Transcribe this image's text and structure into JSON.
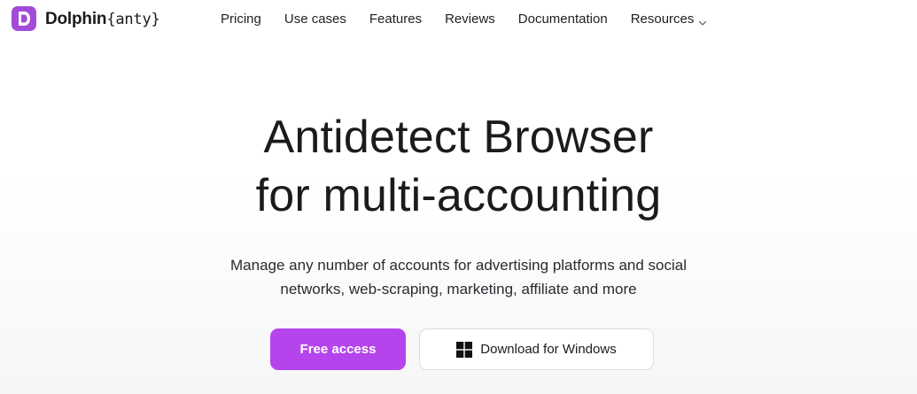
{
  "brand": {
    "name_bold": "Dolphin",
    "name_light": "{anty}",
    "accent_color": "#a34bd9",
    "icon": "dolphin-logo-icon"
  },
  "nav": {
    "items": [
      {
        "label": "Pricing"
      },
      {
        "label": "Use cases"
      },
      {
        "label": "Features"
      },
      {
        "label": "Reviews"
      },
      {
        "label": "Documentation"
      },
      {
        "label": "Resources",
        "icon": "chevron-down-icon"
      }
    ]
  },
  "hero": {
    "title_line1": "Antidetect Browser",
    "title_line2": "for multi-accounting",
    "subtitle_line1": "Manage any number of accounts for advertising platforms and social",
    "subtitle_line2": "networks, web-scraping, marketing, affiliate and more"
  },
  "cta": {
    "primary_label": "Free access",
    "primary_color": "#b544ec",
    "secondary_label": "Download for Windows",
    "secondary_icon": "windows-icon"
  }
}
